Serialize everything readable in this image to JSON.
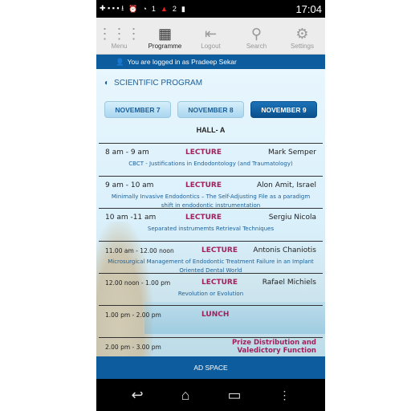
{
  "status": {
    "time": "17:04",
    "notif1": "1",
    "notif2": "2"
  },
  "toolbar": {
    "items": [
      {
        "label": "Menu",
        "icon": "grid-icon"
      },
      {
        "label": "Programme",
        "icon": "calendar-icon"
      },
      {
        "label": "Logout",
        "icon": "logout-icon"
      },
      {
        "label": "Search",
        "icon": "search-icon"
      },
      {
        "label": "Settings",
        "icon": "gear-icon"
      }
    ]
  },
  "login": {
    "text": "You are logged in as Pradeep Sekar"
  },
  "section_title": "SCIENTIFIC PROGRAM",
  "dates": [
    "NOVEMBER 7",
    "NOVEMBER 8",
    "NOVEMBER 9"
  ],
  "selected_date": "NOVEMBER 9",
  "hall": "HALL- A",
  "sessions": [
    {
      "time": "8 am - 9 am",
      "type": "LECTURE",
      "speaker": "Mark Semper",
      "desc": "CBCT - Justifications in Endodontology (and Traumatology)"
    },
    {
      "time": "9 am - 10 am",
      "type": "LECTURE",
      "speaker": "Alon Amit, Israel",
      "desc": "Minimally Invasive Endodontics – The Self-Adjusting File as a paradigm shift in endodontic instrumentation"
    },
    {
      "time": "10 am -11 am",
      "type": "LECTURE",
      "speaker": "Sergiu Nicola",
      "desc": "Separated instrumemts Retrieval Techniques"
    },
    {
      "time": "11.00 am - 12.00 noon",
      "type": "LECTURE",
      "speaker": "Antonis Chaniotis",
      "desc": "Microsurgical Management of Endodontic Treatment Failure in an Implant Oriented Dental World"
    },
    {
      "time": "12.00 noon - 1.00 pm",
      "type": "LECTURE",
      "speaker": "Rafael Michiels",
      "desc": "Revolution or Evolution"
    },
    {
      "time": "1.00 pm - 2.00 pm",
      "type": "LUNCH",
      "speaker": "",
      "desc": ""
    },
    {
      "time": "2.00 pm - 3.00 pm",
      "type": "Prize Distribution and Valedictory Function",
      "speaker": "",
      "desc": ""
    }
  ],
  "ad": "AD SPACE",
  "colors": {
    "brand": "#0d5c9e",
    "accent": "#a0225c"
  }
}
